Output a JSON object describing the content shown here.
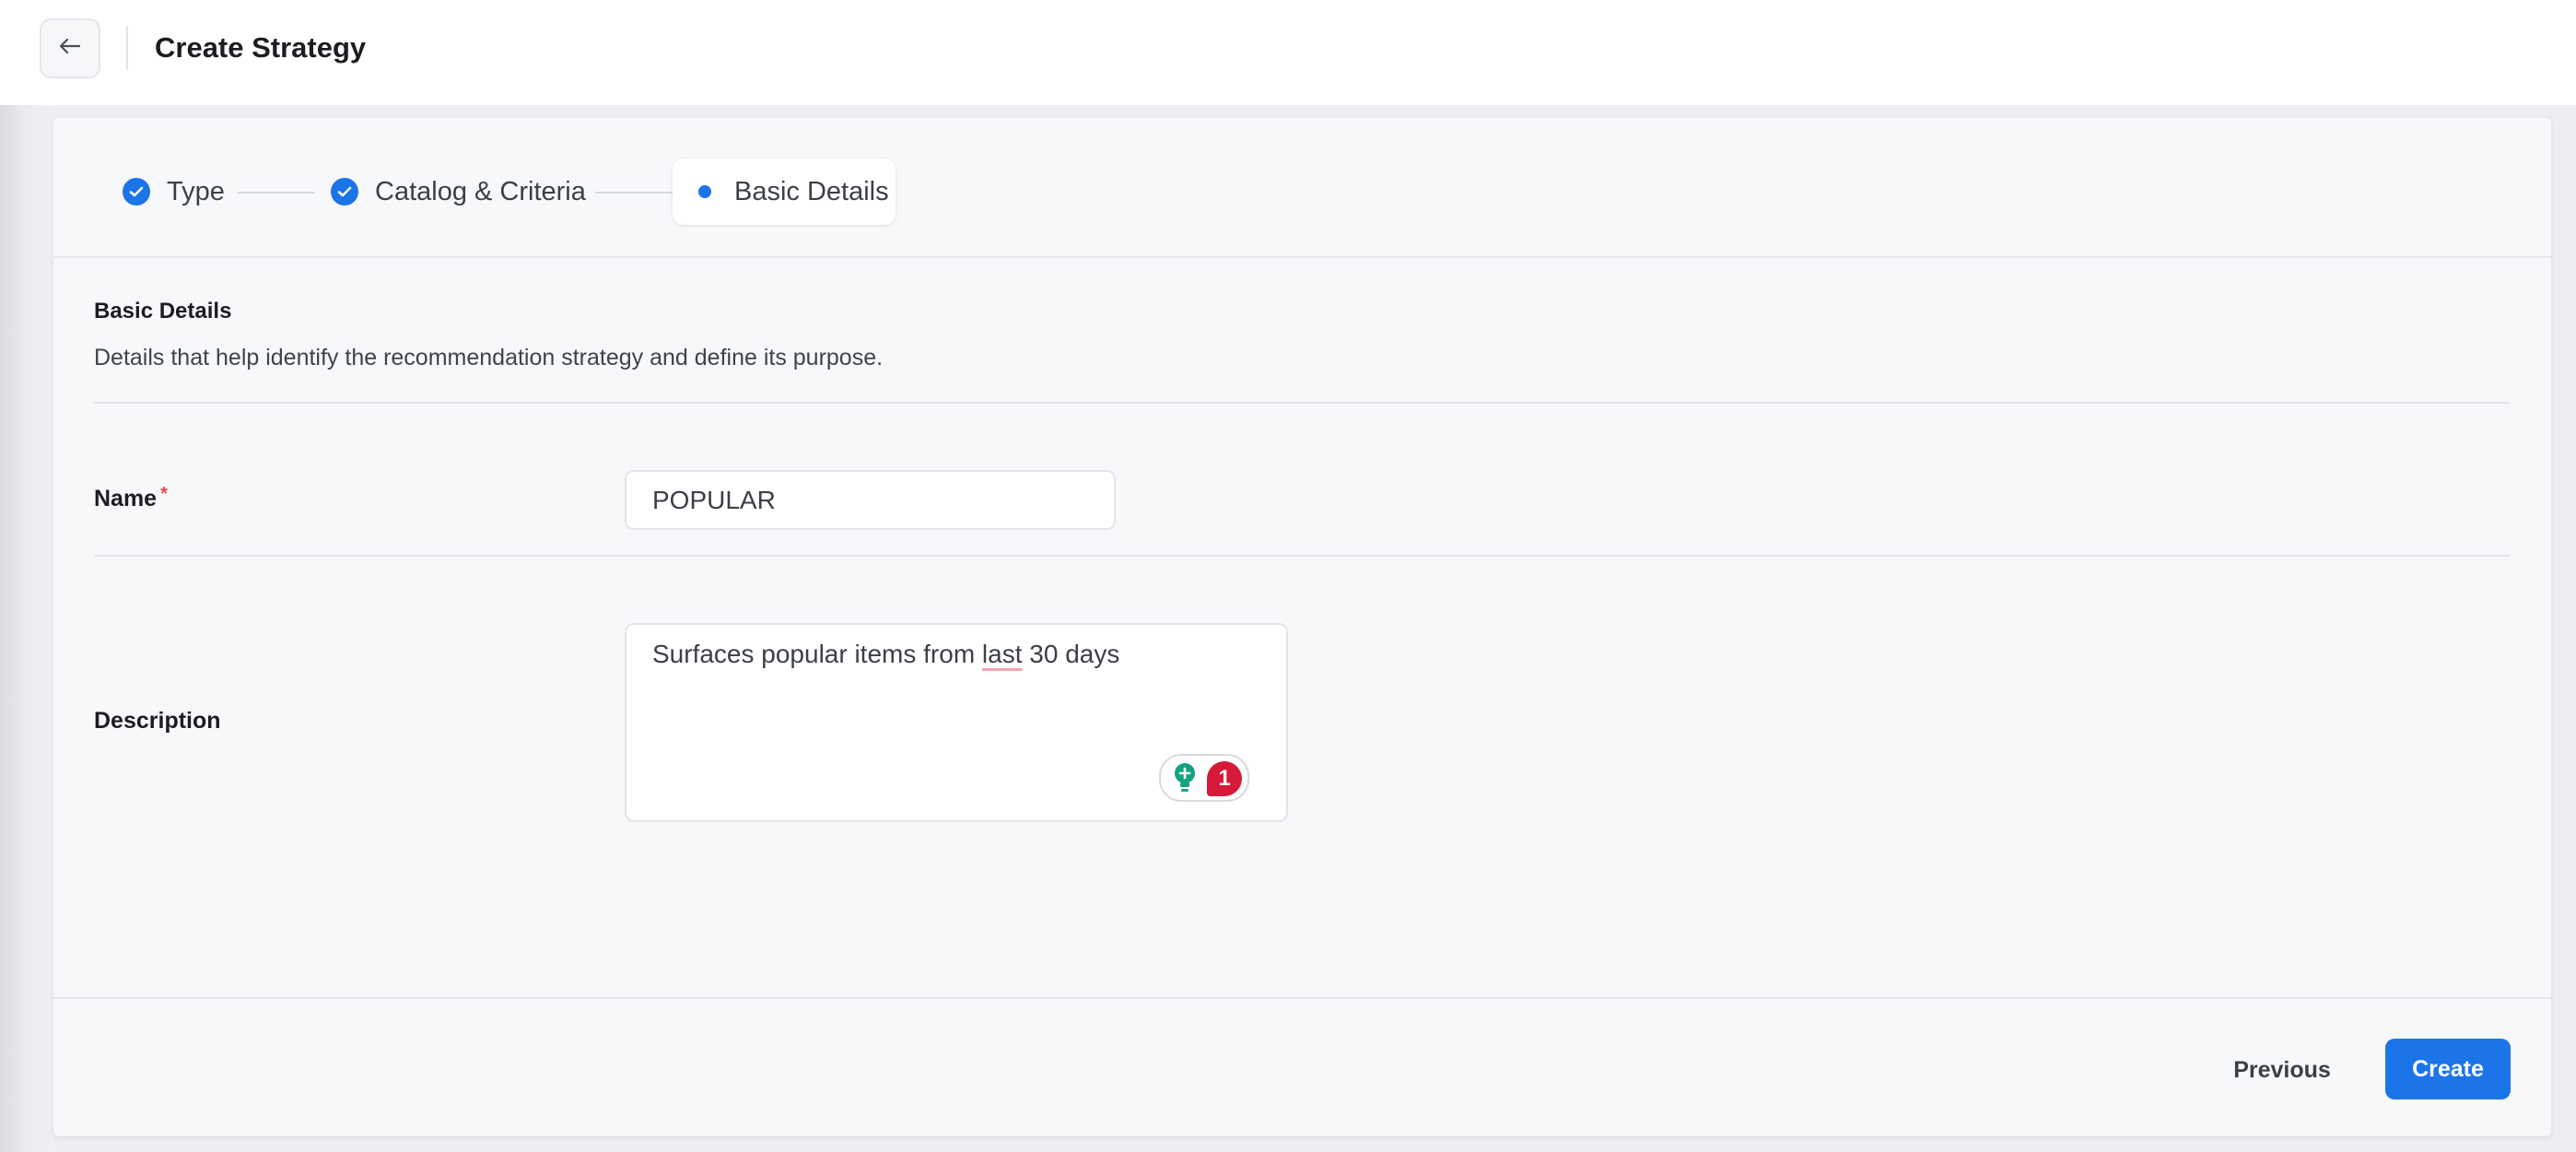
{
  "header": {
    "back_icon": "arrow-left-icon",
    "title": "Create Strategy"
  },
  "stepper": {
    "steps": [
      {
        "label": "Type",
        "status": "completed",
        "icon": "check-circle-icon"
      },
      {
        "label": "Catalog & Criteria",
        "status": "completed",
        "icon": "check-circle-icon"
      },
      {
        "label": "Basic Details",
        "status": "active",
        "icon": "dot-icon"
      }
    ]
  },
  "section": {
    "title": "Basic Details",
    "description": "Details that help identify the recommendation strategy and define its purpose."
  },
  "form": {
    "name_label": "Name",
    "name_required_mark": "*",
    "name_value": "POPULAR",
    "description_label": "Description",
    "description_value": {
      "before": "Surfaces popular items from ",
      "flagged_word": "last",
      "after": " 30 days"
    },
    "grammar_widget": {
      "icon": "lightbulb-icon",
      "issue_count": "1"
    }
  },
  "footer": {
    "previous_label": "Previous",
    "create_label": "Create"
  },
  "colors": {
    "primary": "#1b74e8",
    "required": "#e5484d",
    "badge": "#d7193a",
    "bulb": "#14a37f"
  }
}
